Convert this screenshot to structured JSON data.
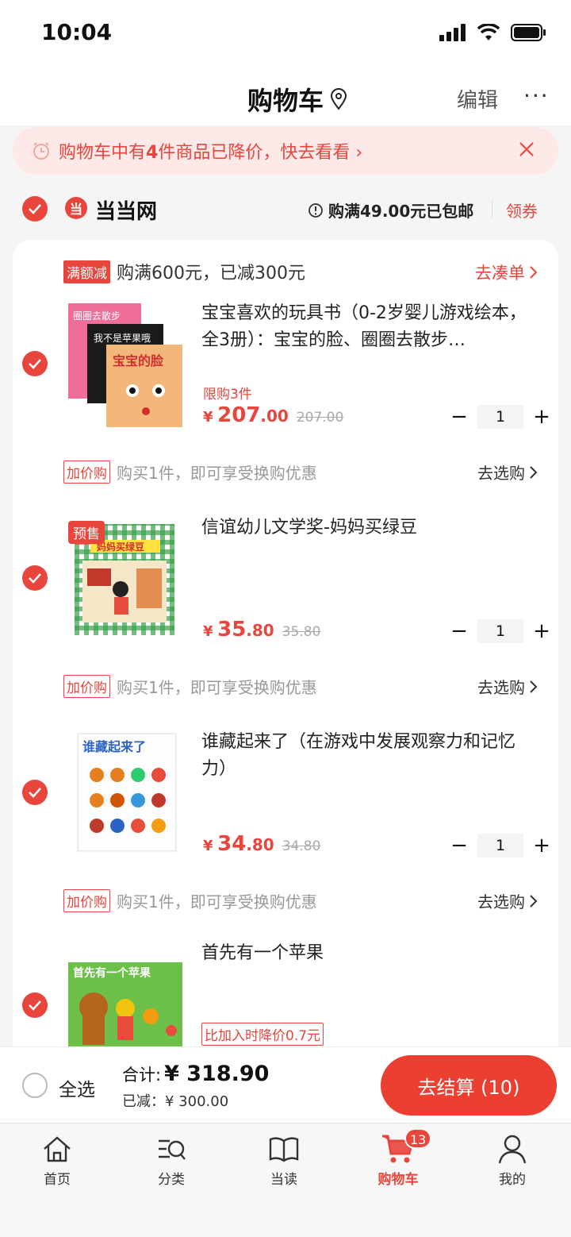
{
  "status_bar": {
    "time": "10:04"
  },
  "header": {
    "title": "购物车",
    "edit": "编辑",
    "more": "···"
  },
  "notice": {
    "prefix": "购物车中有",
    "count": "4",
    "suffix": "件商品已降价，快去看看",
    "arrow": "›"
  },
  "shop": {
    "name": "当当网",
    "logo_char": "当",
    "free_shipping": "购满49.00元已包邮",
    "coupon": "领券"
  },
  "promo": {
    "tag": "满额减",
    "text": "购满600元，已减300元",
    "link": "去凑单"
  },
  "items": [
    {
      "title": "宝宝喜欢的玩具书（0-2岁婴儿游戏绘本，全3册）：宝宝的脸、圈圈去散步…",
      "limit": "限购3件",
      "price_yen": "¥",
      "price_int": "207",
      "price_dec": ".00",
      "original": "207.00",
      "qty": "1",
      "addbuy_tag": "加价购",
      "addbuy_text": "购买1件，即可享受换购优惠",
      "addbuy_link": "去选购",
      "cover_texts": [
        "圈圈去散步",
        "我不是苹果哦",
        "宝宝的脸"
      ]
    },
    {
      "title": "信谊幼儿文学奖-妈妈买绿豆",
      "presale": "预售",
      "price_yen": "¥",
      "price_int": "35",
      "price_dec": ".80",
      "original": "35.80",
      "qty": "1",
      "addbuy_tag": "加价购",
      "addbuy_text": "购买1件，即可享受换购优惠",
      "addbuy_link": "去选购",
      "cover_texts": [
        "妈妈买绿豆"
      ]
    },
    {
      "title": "谁藏起来了（在游戏中发展观察力和记忆力）",
      "price_yen": "¥",
      "price_int": "34",
      "price_dec": ".80",
      "original": "34.80",
      "qty": "1",
      "addbuy_tag": "加价购",
      "addbuy_text": "购买1件，即可享受换购优惠",
      "addbuy_link": "去选购",
      "cover_texts": [
        "谁藏起来了"
      ]
    },
    {
      "title": "首先有一个苹果",
      "drop_tag": "比加入时降价0.7元",
      "cover_texts": [
        "首先有一个苹果"
      ]
    }
  ],
  "checkout": {
    "select_all": "全选",
    "total_label": "合计:",
    "total_value": "¥ 318.90",
    "saved": "已减：¥ 300.00",
    "button": "去结算 (10)"
  },
  "tabs": [
    {
      "label": "首页",
      "icon": "home-icon"
    },
    {
      "label": "分类",
      "icon": "category-search-icon"
    },
    {
      "label": "当读",
      "icon": "book-icon"
    },
    {
      "label": "购物车",
      "icon": "cart-icon",
      "badge": "13",
      "active": true
    },
    {
      "label": "我的",
      "icon": "profile-icon"
    }
  ],
  "colors": {
    "accent": "#e8453c",
    "notice_bg": "#fde9e7",
    "checkout": "#ea3f31"
  }
}
